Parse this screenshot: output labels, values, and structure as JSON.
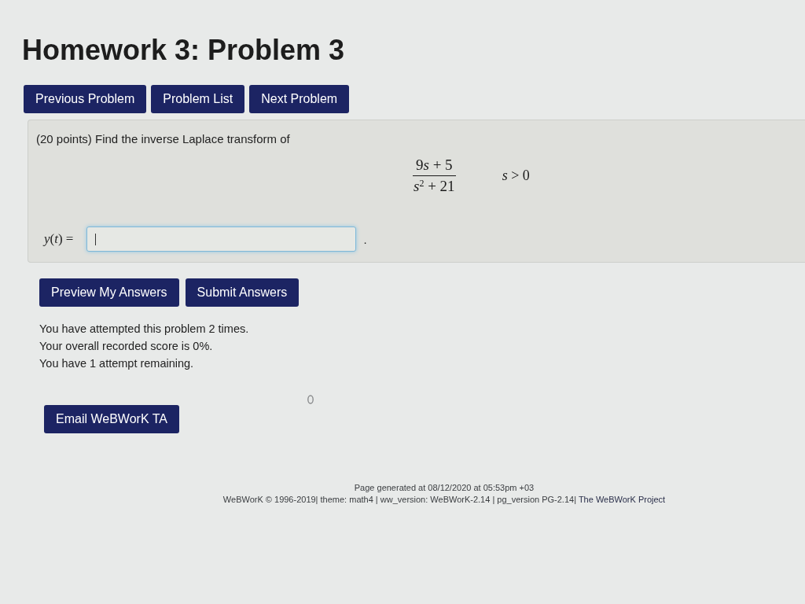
{
  "page": {
    "title": "Homework 3: Problem 3"
  },
  "nav_buttons": [
    "Previous Problem",
    "Problem List",
    "Next Problem"
  ],
  "problem": {
    "statement": "(20 points) Find the inverse Laplace transform of",
    "expression": {
      "numerator": [
        "9",
        "*s* + 5"
      ],
      "denominator": "*s*$^{2}$ + 21",
      "condition": "*s* > 0"
    },
    "answer": {
      "label": "*y*(*t*) =",
      "focused": true,
      "after_field": "."
    }
  },
  "action_buttons": [
    "Preview My Answers",
    "Submit Answers"
  ],
  "messages": [
    "You have attempted this problem 2 times.",
    "Your overall recorded score is 0%.",
    "You have 1 attempt remaining."
  ],
  "email_button": "Email WeBWorK TA",
  "footer": {
    "generated": "Page generated at 08/12/2020 at 05:53pm +03",
    "copyright": "WeBWorK © 1996-2019| theme: math4 | ww_version: WeBWorK-2.14 | pg_version PG-2.14|",
    "link": "The WeBWorK Project"
  }
}
